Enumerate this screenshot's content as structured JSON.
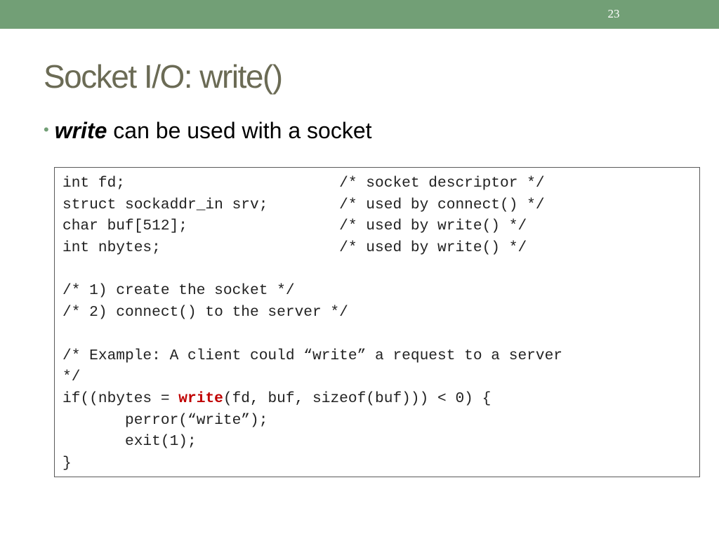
{
  "slide": {
    "number": "23",
    "title": "Socket I/O: write()",
    "bullet": {
      "keyword": "write",
      "text": " can be used with a socket"
    }
  },
  "code": {
    "lines": [
      "int fd;                        /* socket descriptor */",
      "struct sockaddr_in srv;        /* used by connect() */",
      "char buf[512];                 /* used by write() */",
      "int nbytes;                    /* used by write() */",
      "",
      "/* 1) create the socket */",
      "/* 2) connect() to the server */",
      "",
      "/* Example: A client could “write” a request to a server",
      "*/",
      "",
      "       perror(“write”);",
      "       exit(1);",
      "}"
    ],
    "write_call": {
      "before": "if((nbytes = ",
      "keyword": "write",
      "after": "(fd, buf, sizeof(buf))) < 0) {"
    },
    "colors": {
      "keyword_highlight": "#c00000"
    }
  },
  "theme": {
    "top_bar_color": "#729f76",
    "title_color": "#6b6b55"
  }
}
